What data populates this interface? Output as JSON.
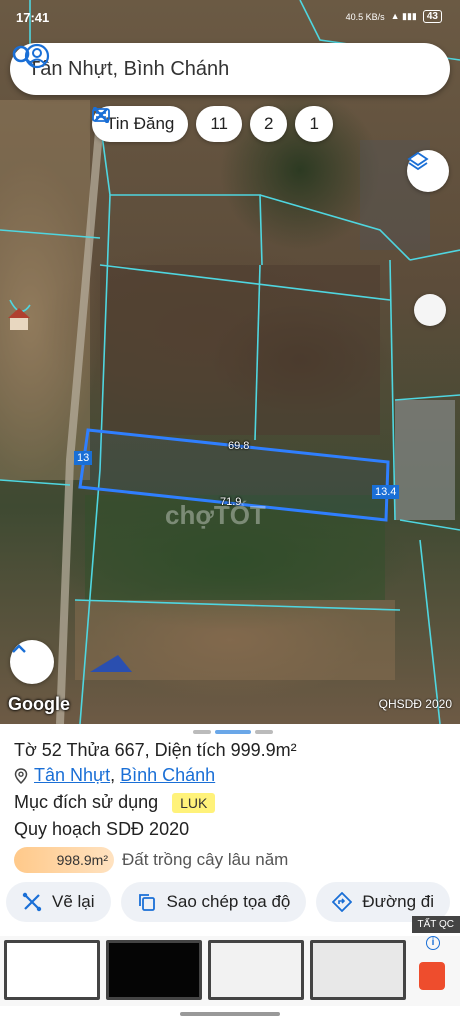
{
  "status_bar": {
    "time": "17:41",
    "network": "40.5 KB/s",
    "battery": "43"
  },
  "search": {
    "text": "Tân Nhựt, Bình Chánh"
  },
  "chips": [
    {
      "label": "Tin Đăng"
    },
    {
      "label": "11"
    },
    {
      "label": "2"
    },
    {
      "label": "1"
    }
  ],
  "map": {
    "dimensions": [
      "69.8",
      "71.9",
      "13",
      "13.4"
    ],
    "attribution": "Google",
    "layer_label": "QHSDĐ 2020",
    "watermark": "chợTỐT",
    "boundary_color": "#2f7fff",
    "parcel_line_color": "#4fd6e0"
  },
  "parcel": {
    "title": "Tờ 52 Thửa 667, Diện tích 999.9m²",
    "ward": "Tân Nhựt",
    "separator": ",",
    "district": "Bình Chánh",
    "purpose_label": "Mục đích sử dụng",
    "purpose_code": "LUK",
    "plan_label": "Quy hoạch SDĐ 2020",
    "plan_area": "998.9m²",
    "plan_type": "Đất trồng cây lâu năm"
  },
  "actions": [
    {
      "label": "Vẽ lại",
      "icon": "redraw-icon"
    },
    {
      "label": "Sao chép tọa độ",
      "icon": "copy-icon"
    },
    {
      "label": "Đường đi",
      "icon": "directions-icon"
    }
  ],
  "ad": {
    "tag": "TẤT QC"
  }
}
